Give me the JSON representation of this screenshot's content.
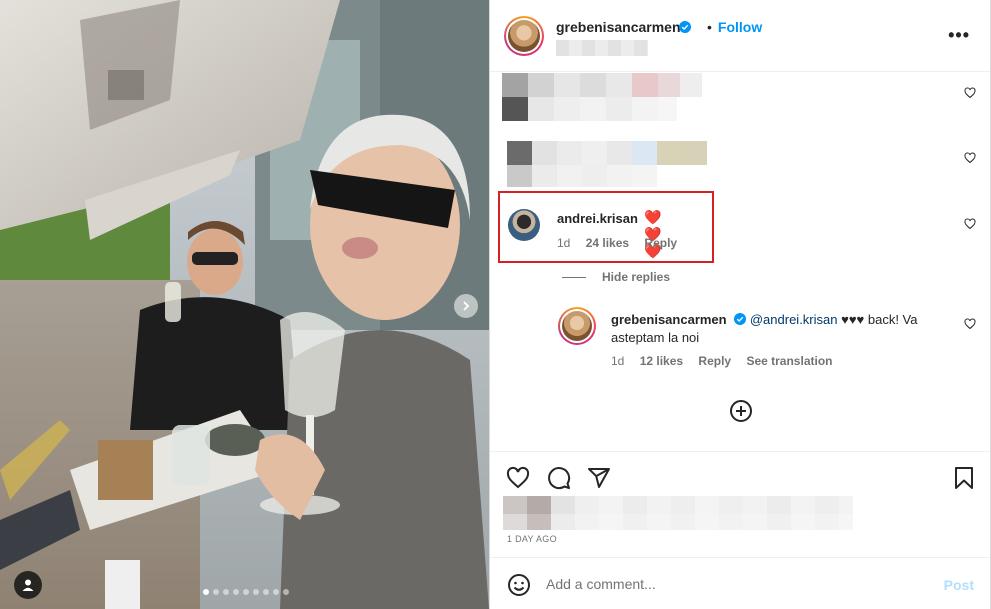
{
  "post": {
    "username": "grebenisancarmen",
    "follow_label": "Follow",
    "more_label": "•••"
  },
  "comments": [
    {
      "username": "andrei.krisan",
      "text": "❤️❤️❤️",
      "age": "1d",
      "likes": "24 likes",
      "reply_label": "Reply"
    }
  ],
  "hide_replies_label": "Hide replies",
  "reply": {
    "username": "grebenisancarmen",
    "mention": "@andrei.krisan",
    "text": " ♥♥♥ back! Va asteptam la noi",
    "age": "1d",
    "likes": "12 likes",
    "reply_label": "Reply",
    "translation_label": "See translation"
  },
  "timestamp": "1 DAY AGO",
  "add_comment": {
    "placeholder": "Add a comment...",
    "post_label": "Post"
  },
  "carousel": {
    "dot_count": 9,
    "active_index": 0
  },
  "colors": {
    "accent": "#0095f6",
    "highlight_box": "#d71f26",
    "heart_red": "#ed1c24",
    "post_disabled": "#b2dffc"
  }
}
